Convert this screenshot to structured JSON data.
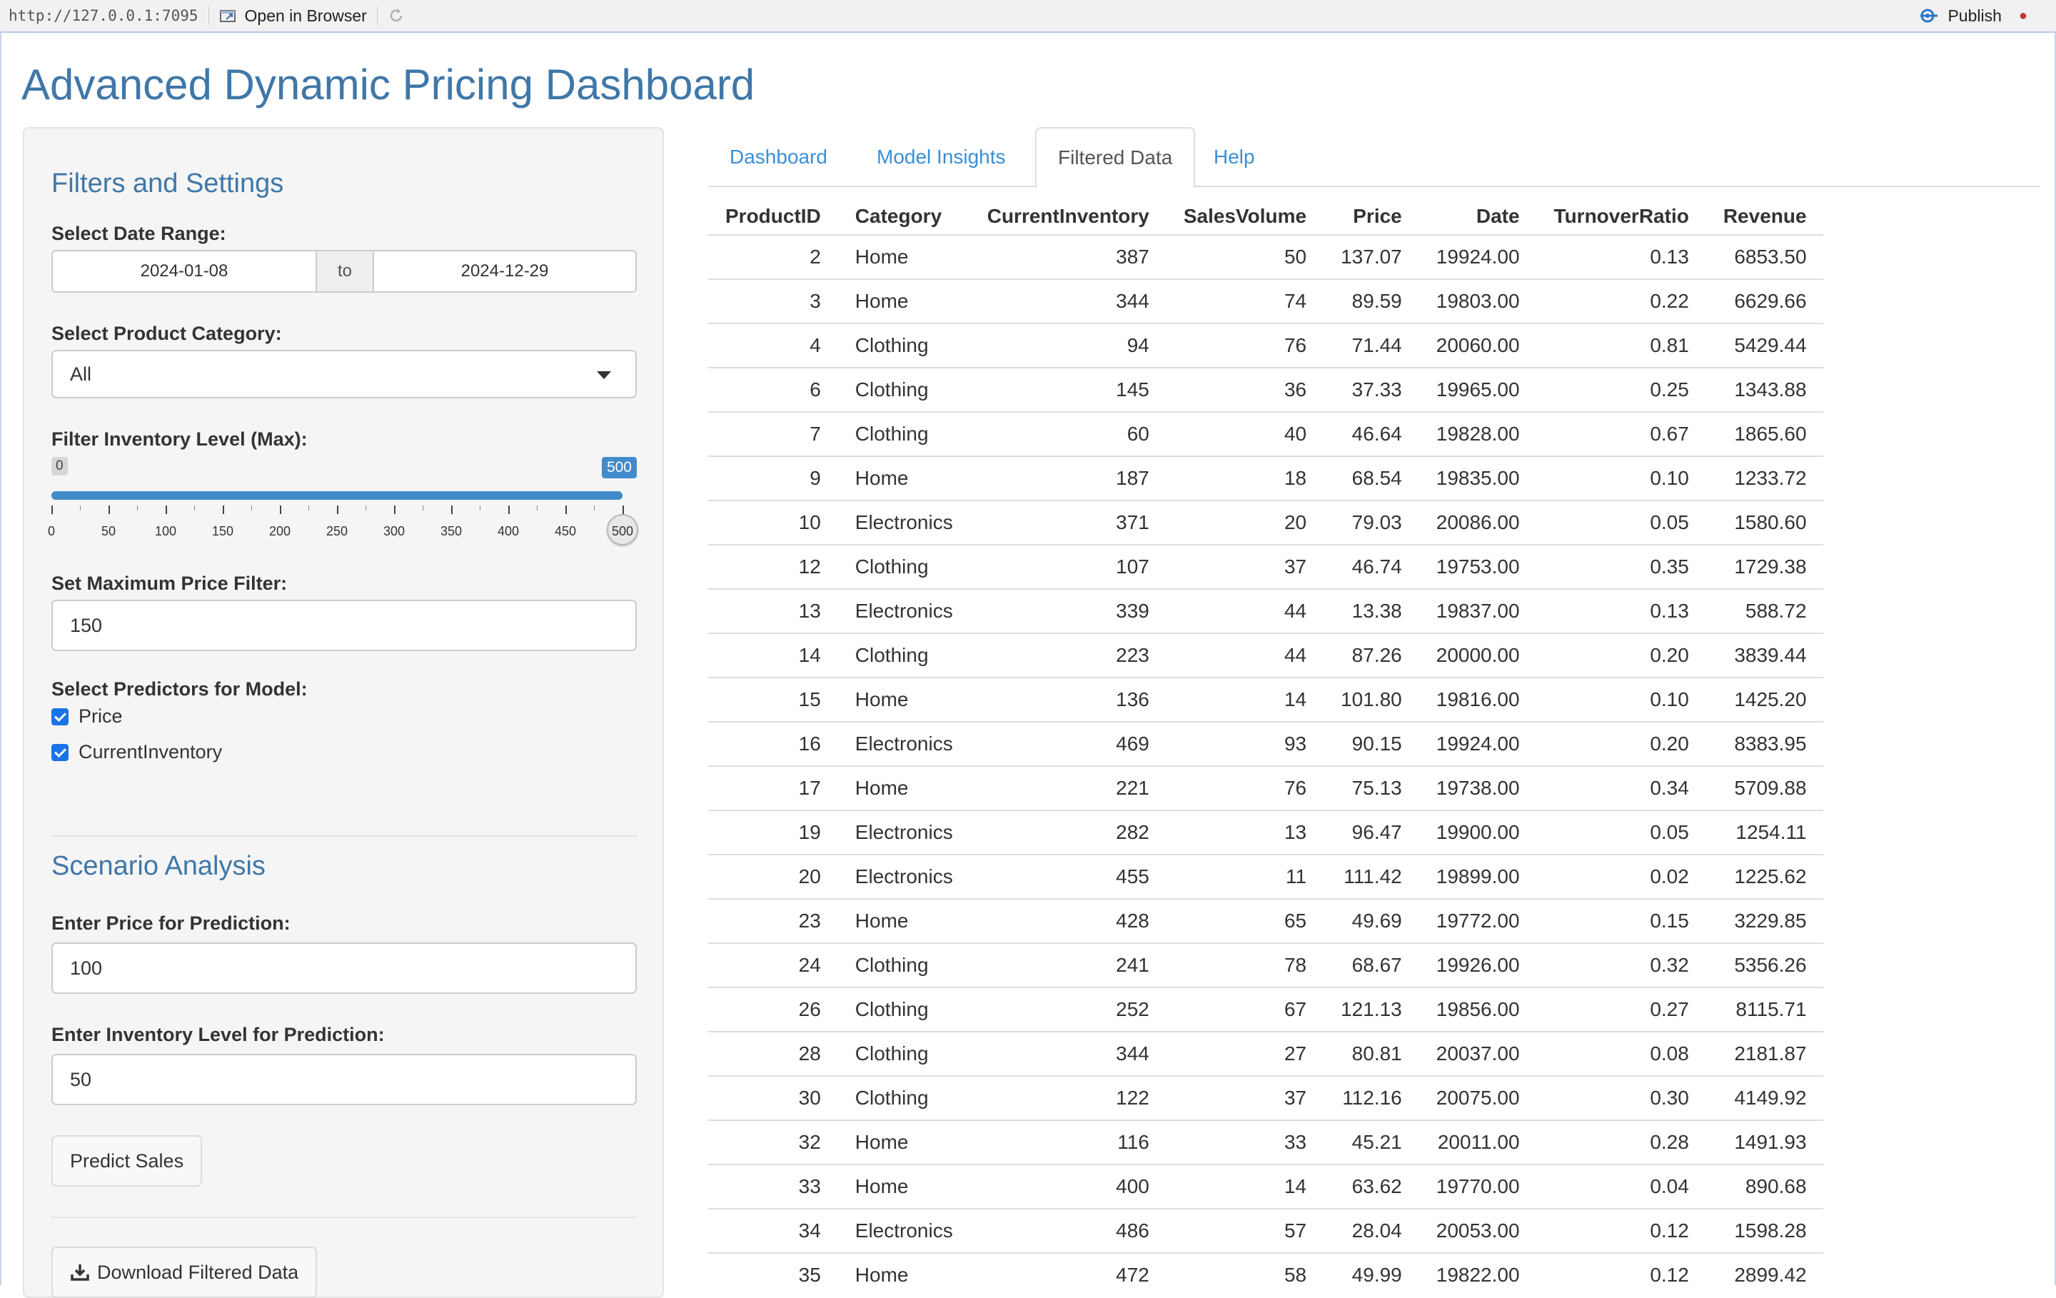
{
  "topbar": {
    "url": "http://127.0.0.1:7095",
    "open_browser": "Open in Browser",
    "publish": "Publish"
  },
  "title": "Advanced Dynamic Pricing Dashboard",
  "sidebar": {
    "filters_heading": "Filters and Settings",
    "date_label": "Select Date Range:",
    "date_start": "2024-01-08",
    "date_to": "to",
    "date_end": "2024-12-29",
    "category_label": "Select Product Category:",
    "category_value": "All",
    "inventory_label": "Filter Inventory Level (Max):",
    "slider": {
      "min": 0,
      "max": 500,
      "value": 500,
      "min_label": "0",
      "value_label": "500",
      "tick_labels": [
        "0",
        "50",
        "100",
        "150",
        "200",
        "250",
        "300",
        "350",
        "400",
        "450",
        "500"
      ]
    },
    "price_label": "Set Maximum Price Filter:",
    "price_value": "150",
    "predictors_label": "Select Predictors for Model:",
    "predictors": [
      {
        "label": "Price",
        "checked": true
      },
      {
        "label": "CurrentInventory",
        "checked": true
      }
    ],
    "scenario_heading": "Scenario Analysis",
    "pred_price_label": "Enter Price for Prediction:",
    "pred_price_value": "100",
    "pred_inv_label": "Enter Inventory Level for Prediction:",
    "pred_inv_value": "50",
    "predict_button": "Predict Sales",
    "download_button": "Download Filtered Data"
  },
  "tabs": [
    {
      "label": "Dashboard",
      "active": false
    },
    {
      "label": "Model Insights",
      "active": false
    },
    {
      "label": "Filtered Data",
      "active": true
    },
    {
      "label": "Help",
      "active": false
    }
  ],
  "table": {
    "columns": [
      "ProductID",
      "Category",
      "CurrentInventory",
      "SalesVolume",
      "Price",
      "Date",
      "TurnoverRatio",
      "Revenue"
    ],
    "rows": [
      [
        "2",
        "Home",
        "387",
        "50",
        "137.07",
        "19924.00",
        "0.13",
        "6853.50"
      ],
      [
        "3",
        "Home",
        "344",
        "74",
        "89.59",
        "19803.00",
        "0.22",
        "6629.66"
      ],
      [
        "4",
        "Clothing",
        "94",
        "76",
        "71.44",
        "20060.00",
        "0.81",
        "5429.44"
      ],
      [
        "6",
        "Clothing",
        "145",
        "36",
        "37.33",
        "19965.00",
        "0.25",
        "1343.88"
      ],
      [
        "7",
        "Clothing",
        "60",
        "40",
        "46.64",
        "19828.00",
        "0.67",
        "1865.60"
      ],
      [
        "9",
        "Home",
        "187",
        "18",
        "68.54",
        "19835.00",
        "0.10",
        "1233.72"
      ],
      [
        "10",
        "Electronics",
        "371",
        "20",
        "79.03",
        "20086.00",
        "0.05",
        "1580.60"
      ],
      [
        "12",
        "Clothing",
        "107",
        "37",
        "46.74",
        "19753.00",
        "0.35",
        "1729.38"
      ],
      [
        "13",
        "Electronics",
        "339",
        "44",
        "13.38",
        "19837.00",
        "0.13",
        "588.72"
      ],
      [
        "14",
        "Clothing",
        "223",
        "44",
        "87.26",
        "20000.00",
        "0.20",
        "3839.44"
      ],
      [
        "15",
        "Home",
        "136",
        "14",
        "101.80",
        "19816.00",
        "0.10",
        "1425.20"
      ],
      [
        "16",
        "Electronics",
        "469",
        "93",
        "90.15",
        "19924.00",
        "0.20",
        "8383.95"
      ],
      [
        "17",
        "Home",
        "221",
        "76",
        "75.13",
        "19738.00",
        "0.34",
        "5709.88"
      ],
      [
        "19",
        "Electronics",
        "282",
        "13",
        "96.47",
        "19900.00",
        "0.05",
        "1254.11"
      ],
      [
        "20",
        "Electronics",
        "455",
        "11",
        "111.42",
        "19899.00",
        "0.02",
        "1225.62"
      ],
      [
        "23",
        "Home",
        "428",
        "65",
        "49.69",
        "19772.00",
        "0.15",
        "3229.85"
      ],
      [
        "24",
        "Clothing",
        "241",
        "78",
        "68.67",
        "19926.00",
        "0.32",
        "5356.26"
      ],
      [
        "26",
        "Clothing",
        "252",
        "67",
        "121.13",
        "19856.00",
        "0.27",
        "8115.71"
      ],
      [
        "28",
        "Clothing",
        "344",
        "27",
        "80.81",
        "20037.00",
        "0.08",
        "2181.87"
      ],
      [
        "30",
        "Clothing",
        "122",
        "37",
        "112.16",
        "20075.00",
        "0.30",
        "4149.92"
      ],
      [
        "32",
        "Home",
        "116",
        "33",
        "45.21",
        "20011.00",
        "0.28",
        "1491.93"
      ],
      [
        "33",
        "Home",
        "400",
        "14",
        "63.62",
        "19770.00",
        "0.04",
        "890.68"
      ],
      [
        "34",
        "Electronics",
        "486",
        "57",
        "28.04",
        "20053.00",
        "0.12",
        "1598.28"
      ],
      [
        "35",
        "Home",
        "472",
        "58",
        "49.99",
        "19822.00",
        "0.12",
        "2899.42"
      ]
    ]
  },
  "colors": {
    "accent": "#3f77a8",
    "link": "#3a8fd8",
    "slider": "#428bca",
    "checkbox": "#1a73e8"
  }
}
